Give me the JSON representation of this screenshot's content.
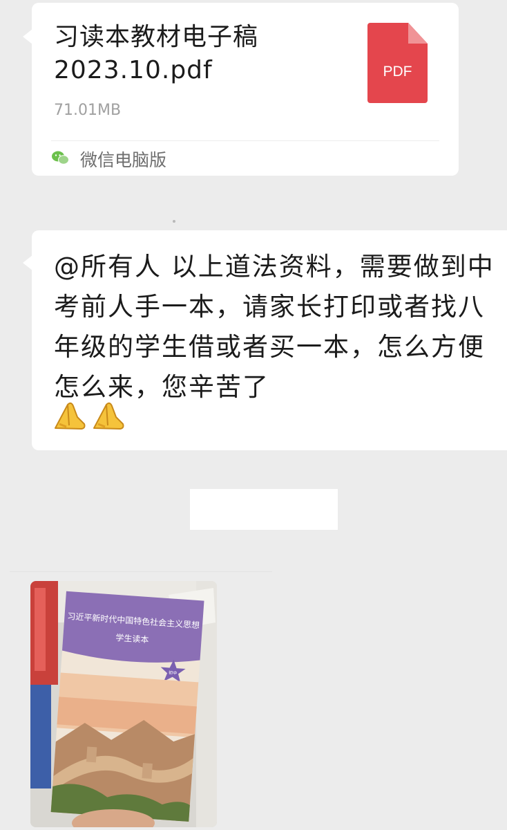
{
  "file_message": {
    "name": "习读本教材电子稿\n2023.10.pdf",
    "size": "71.01MB",
    "icon_label": "PDF",
    "icon_color": "#e4464d",
    "source": "微信电脑版"
  },
  "text_message": {
    "text": "@所有人 以上道法资料，需要做到中考前人手一本，请家长打印或者找八年级的学生借或者买一本，怎么方便怎么来，您辛苦了",
    "emojis": [
      "folded-hands-icon",
      "folded-hands-icon"
    ]
  },
  "image_message": {
    "book_title": "习近平新时代中国特色社会主义思想",
    "book_subtitle": "学生读本",
    "book_badge": "初中"
  }
}
